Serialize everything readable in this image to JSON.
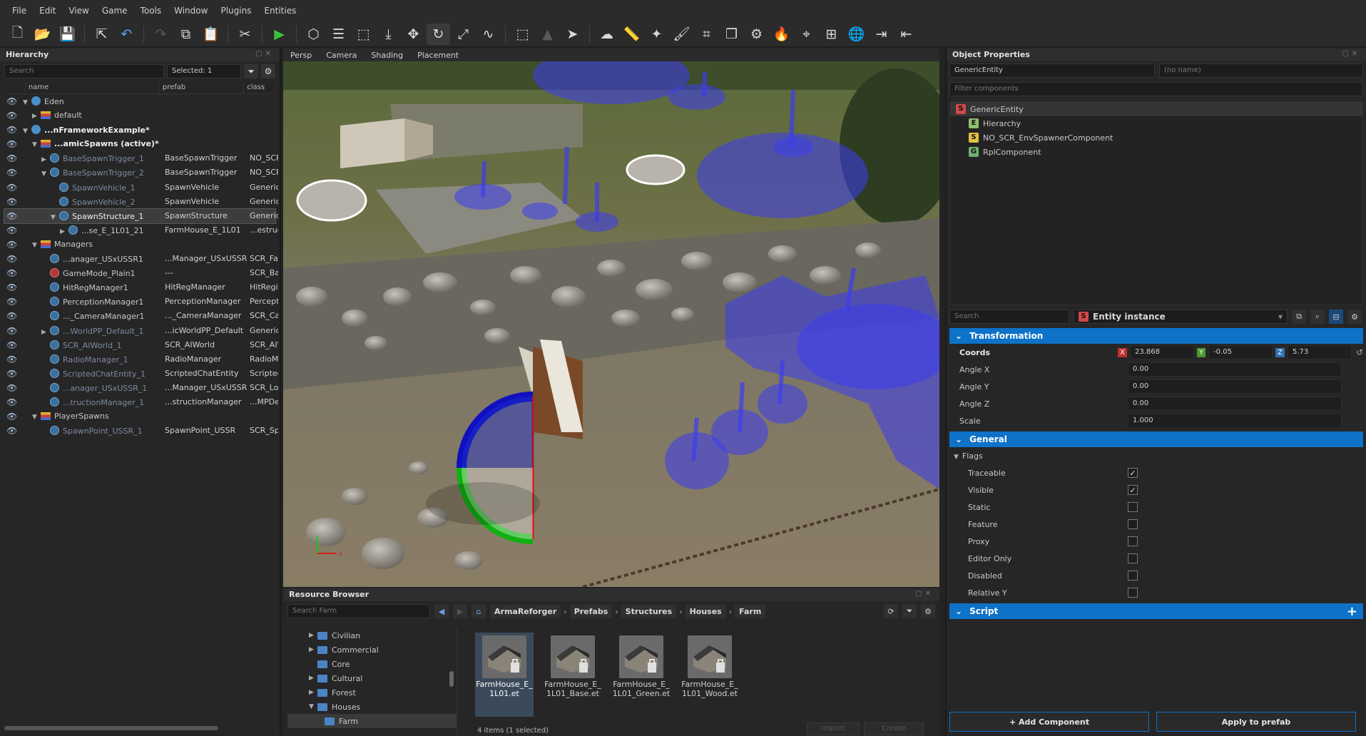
{
  "menu": [
    "File",
    "Edit",
    "View",
    "Game",
    "Tools",
    "Window",
    "Plugins",
    "Entities"
  ],
  "toolbar_icons": [
    "new-file",
    "open-folder",
    "save",
    "export",
    "undo",
    "redo",
    "copy",
    "paste",
    "cut",
    "play",
    "cube",
    "layers",
    "select-region",
    "place",
    "move",
    "rotate",
    "scale",
    "curve",
    "box-select",
    "terrain",
    "arrow",
    "weather",
    "ruler",
    "wand",
    "brush",
    "crop",
    "stack",
    "gear",
    "fire",
    "map-pin",
    "grid",
    "globe",
    "import",
    "export-arrow"
  ],
  "hierarchy": {
    "title": "Hierarchy",
    "search_placeholder": "Search",
    "selected": "Selected: 1",
    "columns": [
      "name",
      "prefab",
      "class"
    ],
    "rows": [
      {
        "name": "Eden",
        "prefab": "",
        "cls": "",
        "indent": 0,
        "arrow": "▼",
        "icon": "world",
        "style": ""
      },
      {
        "name": "default",
        "prefab": "",
        "cls": "",
        "indent": 1,
        "arrow": "▶",
        "icon": "layer",
        "style": ""
      },
      {
        "name": "...nFrameworkExample*",
        "prefab": "",
        "cls": "",
        "indent": 0,
        "arrow": "▼",
        "icon": "world",
        "style": "bold"
      },
      {
        "name": "...amicSpawns (active)*",
        "prefab": "",
        "cls": "",
        "indent": 1,
        "arrow": "▼",
        "icon": "layer",
        "style": "bold"
      },
      {
        "name": "BaseSpawnTrigger_1",
        "prefab": "BaseSpawnTrigger",
        "cls": "NO_SCR",
        "indent": 2,
        "arrow": "▶",
        "icon": "ent",
        "style": "muted"
      },
      {
        "name": "BaseSpawnTrigger_2",
        "prefab": "BaseSpawnTrigger",
        "cls": "NO_SCR",
        "indent": 2,
        "arrow": "▼",
        "icon": "ent",
        "style": "muted"
      },
      {
        "name": "SpawnVehicle_1",
        "prefab": "SpawnVehicle",
        "cls": "GenericE",
        "indent": 3,
        "arrow": "",
        "icon": "ent",
        "style": "muted"
      },
      {
        "name": "SpawnVehicle_2",
        "prefab": "SpawnVehicle",
        "cls": "GenericE",
        "indent": 3,
        "arrow": "",
        "icon": "ent",
        "style": "muted"
      },
      {
        "name": "SpawnStructure_1",
        "prefab": "SpawnStructure",
        "cls": "GenericE",
        "indent": 3,
        "arrow": "▼",
        "icon": "ent",
        "style": "",
        "sel": true
      },
      {
        "name": "...se_E_1L01_21",
        "prefab": "FarmHouse_E_1L01",
        "cls": "...estruc",
        "indent": 4,
        "arrow": "▶",
        "icon": "ent",
        "style": ""
      },
      {
        "name": "Managers",
        "prefab": "",
        "cls": "",
        "indent": 1,
        "arrow": "▼",
        "icon": "layer",
        "style": ""
      },
      {
        "name": "...anager_USxUSSR1",
        "prefab": "...Manager_USxUSSR",
        "cls": "SCR_Fac",
        "indent": 2,
        "arrow": "",
        "icon": "ent",
        "style": ""
      },
      {
        "name": "GameMode_Plain1",
        "prefab": "---",
        "cls": "SCR_Bas",
        "indent": 2,
        "arrow": "",
        "icon": "red",
        "style": ""
      },
      {
        "name": "HitRegManager1",
        "prefab": "HitRegManager",
        "cls": "HitRegis",
        "indent": 2,
        "arrow": "",
        "icon": "ent",
        "style": ""
      },
      {
        "name": "PerceptionManager1",
        "prefab": "PerceptionManager",
        "cls": "Percepti",
        "indent": 2,
        "arrow": "",
        "icon": "ent",
        "style": ""
      },
      {
        "name": "..._CameraManager1",
        "prefab": "..._CameraManager",
        "cls": "SCR_Car",
        "indent": 2,
        "arrow": "",
        "icon": "ent",
        "style": ""
      },
      {
        "name": "...WorldPP_Default_1",
        "prefab": "...icWorldPP_Default",
        "cls": "GenericE",
        "indent": 2,
        "arrow": "▶",
        "icon": "ent",
        "style": "muted"
      },
      {
        "name": "SCR_AIWorld_1",
        "prefab": "SCR_AIWorld",
        "cls": "SCR_AIW",
        "indent": 2,
        "arrow": "",
        "icon": "ent",
        "style": "muted"
      },
      {
        "name": "RadioManager_1",
        "prefab": "RadioManager",
        "cls": "RadioMa",
        "indent": 2,
        "arrow": "",
        "icon": "ent",
        "style": "muted"
      },
      {
        "name": "ScriptedChatEntity_1",
        "prefab": "ScriptedChatEntity",
        "cls": "Scripted",
        "indent": 2,
        "arrow": "",
        "icon": "ent",
        "style": "muted"
      },
      {
        "name": "...anager_USxUSSR_1",
        "prefab": "...Manager_USxUSSR",
        "cls": "SCR_Loa",
        "indent": 2,
        "arrow": "",
        "icon": "ent",
        "style": "muted"
      },
      {
        "name": "...tructionManager_1",
        "prefab": "...structionManager",
        "cls": "...MPDe",
        "indent": 2,
        "arrow": "",
        "icon": "ent",
        "style": "muted"
      },
      {
        "name": "PlayerSpawns",
        "prefab": "",
        "cls": "",
        "indent": 1,
        "arrow": "▼",
        "icon": "layer",
        "style": ""
      },
      {
        "name": "SpawnPoint_USSR_1",
        "prefab": "SpawnPoint_USSR",
        "cls": "SCR_Spa",
        "indent": 2,
        "arrow": "",
        "icon": "ent",
        "style": "muted"
      }
    ]
  },
  "viewport": {
    "tabs": [
      "Persp",
      "Camera",
      "Shading",
      "Placement"
    ]
  },
  "resources": {
    "title": "Resource Browser",
    "search_placeholder": "Search Farm",
    "breadcrumb": [
      "ArmaReforger",
      "Prefabs",
      "Structures",
      "Houses",
      "Farm"
    ],
    "folders": [
      {
        "name": "Civilian",
        "arrow": "▶",
        "indent": 1
      },
      {
        "name": "Commercial",
        "arrow": "▶",
        "indent": 1
      },
      {
        "name": "Core",
        "arrow": "",
        "indent": 1
      },
      {
        "name": "Cultural",
        "arrow": "▶",
        "indent": 1
      },
      {
        "name": "Forest",
        "arrow": "▶",
        "indent": 1
      },
      {
        "name": "Houses",
        "arrow": "▼",
        "indent": 1
      },
      {
        "name": "Farm",
        "arrow": "",
        "indent": 2,
        "sel": true
      }
    ],
    "assets": [
      "FarmHouse_E_1L01.et",
      "FarmHouse_E_1L01_Base.et",
      "FarmHouse_E_1L01_Green.et",
      "FarmHouse_E_1L01_Wood.et"
    ],
    "status": "4 items (1 selected)",
    "import_label": "Import",
    "create_label": "Create"
  },
  "properties": {
    "title": "Object Properties",
    "entity_class": "GenericEntity",
    "name_placeholder": "(no name)",
    "filter_placeholder": "Filter components",
    "components": [
      {
        "name": "GenericEntity",
        "badge": "S",
        "color": "#d04848"
      },
      {
        "name": "Hierarchy",
        "badge": "E",
        "color": "#8fbf6f"
      },
      {
        "name": "NO_SCR_EnvSpawnerComponent",
        "badge": "S",
        "color": "#e0c040"
      },
      {
        "name": "RplComponent",
        "badge": "G",
        "color": "#70b070"
      }
    ],
    "search_placeholder": "Search",
    "instance_label": "Entity instance",
    "transformation": "Transformation",
    "coords_label": "Coords",
    "coords": {
      "x": "23.868",
      "y": "-0.05",
      "z": "5.73"
    },
    "fields": [
      {
        "label": "Angle X",
        "value": "0.00"
      },
      {
        "label": "Angle Y",
        "value": "0.00"
      },
      {
        "label": "Angle Z",
        "value": "0.00"
      },
      {
        "label": "Scale",
        "value": "1.000"
      }
    ],
    "general": "General",
    "flags_label": "Flags",
    "flags": [
      {
        "label": "Traceable",
        "checked": true
      },
      {
        "label": "Visible",
        "checked": true
      },
      {
        "label": "Static",
        "checked": false
      },
      {
        "label": "Feature",
        "checked": false
      },
      {
        "label": "Proxy",
        "checked": false
      },
      {
        "label": "Editor Only",
        "checked": false
      },
      {
        "label": "Disabled",
        "checked": false
      },
      {
        "label": "Relative Y",
        "checked": false
      }
    ],
    "script": "Script",
    "add_component": "+ Add Component",
    "apply_prefab": "Apply to prefab"
  },
  "colors": {
    "accent": "#0d72c8",
    "spawn_area": "#3c3cf0",
    "gizmo_blue": "#1010c0",
    "gizmo_green": "#10b010",
    "gizmo_red": "#d01010"
  }
}
